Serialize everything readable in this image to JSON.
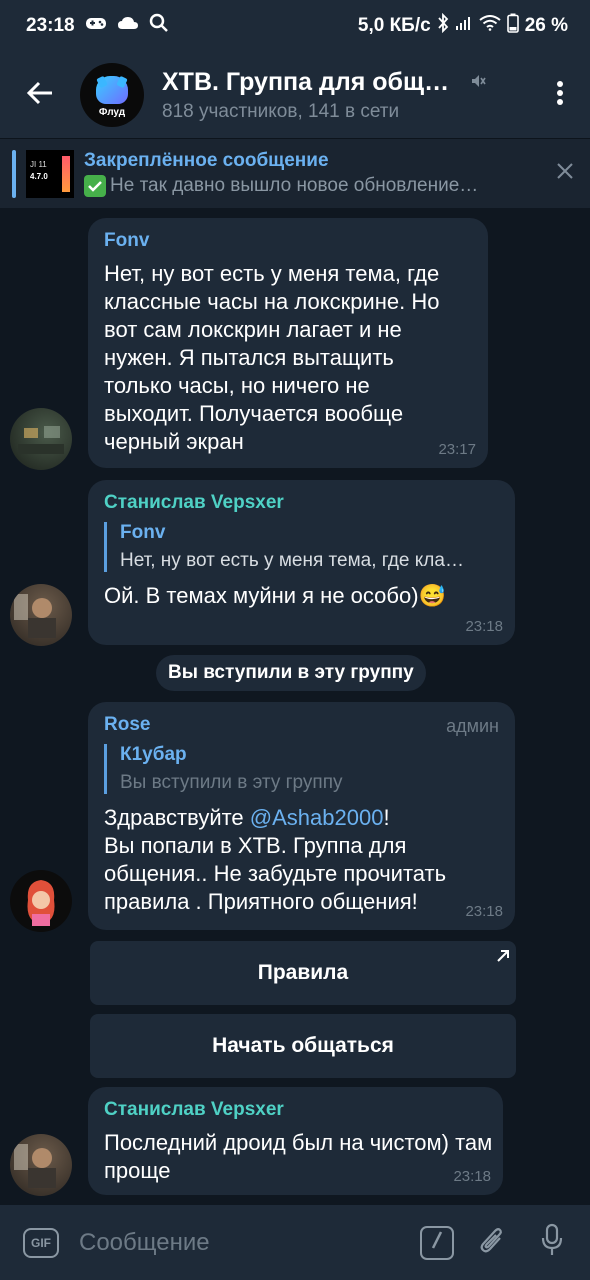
{
  "status": {
    "time": "23:18",
    "speed": "5,0 КБ/с",
    "battery": "26 %"
  },
  "header": {
    "title": "ХТВ. Группа для обще…",
    "subtitle": "818 участников, 141 в сети",
    "avatar_caption": "Флуд"
  },
  "pinned": {
    "label": "Закреплённое сообщение",
    "text": "Не так давно вышло новое обновление…",
    "thumb_line1": "JI 11",
    "thumb_line2": "4.7.0"
  },
  "messages": [
    {
      "sender": "Fonv",
      "text": "Нет, ну вот есть у меня тема, где классные часы на локскрине. Но вот сам локскрин лагает и не нужен. Я пытался вытащить только часы, но ничего не выходит. Получается вообще черный экран",
      "time": "23:17"
    },
    {
      "sender": "Станислав Vepsxer",
      "reply_name": "Fonv",
      "reply_text": "Нет, ну вот есть у меня тема, где кла…",
      "text": "Ой. В темах муйни я не особо)",
      "emoji": "😅",
      "time": "23:18"
    },
    {
      "sender": "Rose",
      "badge": "админ",
      "reply_name": "К1убар",
      "reply_text": "Вы вступили в эту группу",
      "greeting": "Здравствуйте",
      "mention": "@Ashab2000",
      "mention_after": "!",
      "text": "Вы попали в ХТВ. Группа для общения.. Не забудьте прочитать правила . Приятного общения!",
      "time": "23:18"
    },
    {
      "sender": "Станислав Vepsxer",
      "text": "Последний дроид был на чистом) там проще",
      "time": "23:18"
    }
  ],
  "service_message": "Вы вступили в эту группу",
  "keyboard": {
    "rules": "Правила",
    "start": "Начать общаться"
  },
  "input": {
    "placeholder": "Сообщение",
    "gif": "GIF"
  },
  "colors": {
    "accent": "#6bb1f0",
    "sender_fonv": "#6bb1f0",
    "sender_stanislav": "#4fd1c5",
    "sender_rose": "#6bb1f0",
    "bubble": "#1e2a38",
    "background": "#0f1720"
  }
}
